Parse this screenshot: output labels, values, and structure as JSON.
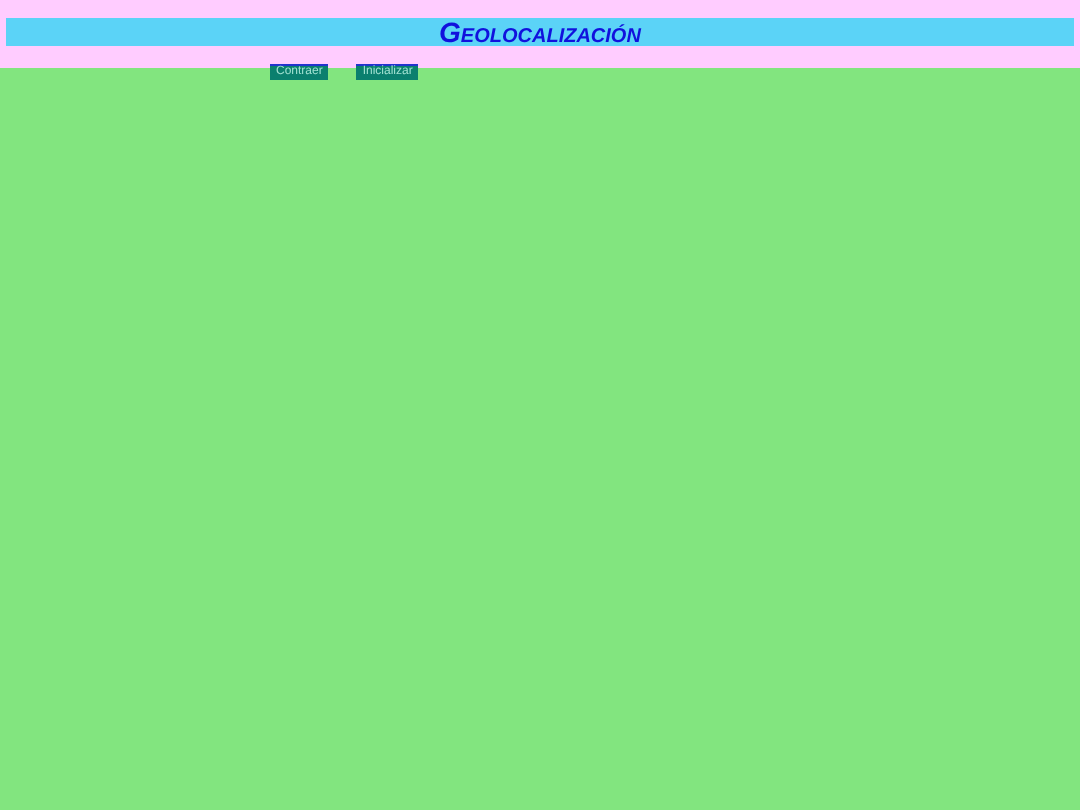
{
  "header": {
    "title": "Geolocalización"
  },
  "buttons": [
    {
      "label": "Contraer"
    },
    {
      "label": "Inicializar"
    }
  ]
}
